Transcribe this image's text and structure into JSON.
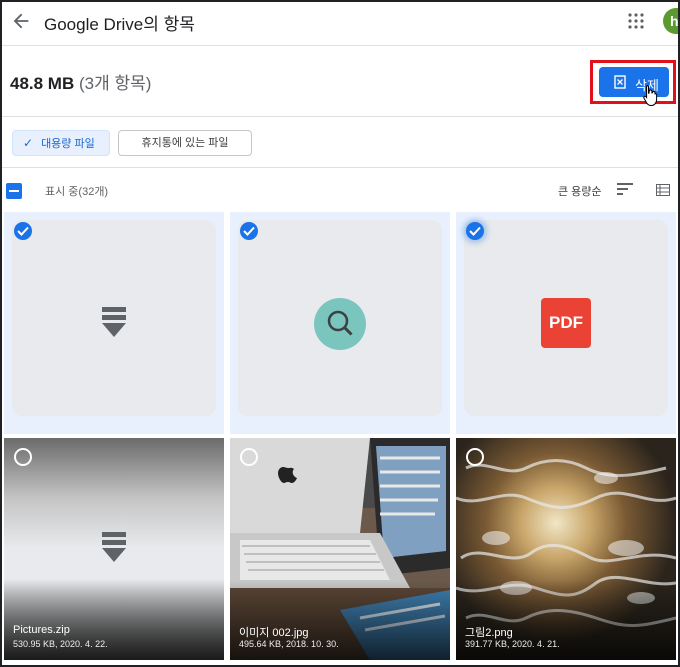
{
  "header": {
    "title": "Google Drive의 항목",
    "avatar_initial": "h"
  },
  "summary": {
    "size": "48.8 MB",
    "count": "(3개 항목)",
    "delete_label": "삭제"
  },
  "filters": {
    "large_files": "대용량 파일",
    "trash_files": "휴지통에 있는 파일"
  },
  "list": {
    "showing": "표시 중(32개)",
    "sort_label": "큰 용량순"
  },
  "files": [
    {
      "type": "zip-icon",
      "selected": true,
      "name": "",
      "meta": ""
    },
    {
      "type": "search-icon",
      "selected": true,
      "name": "",
      "meta": ""
    },
    {
      "type": "pdf-icon",
      "selected": true,
      "name": "",
      "meta": "",
      "badge": "PDF"
    },
    {
      "type": "zip-preview",
      "selected": false,
      "name": "Pictures.zip",
      "meta": "530.95 KB, 2020. 4. 22."
    },
    {
      "type": "photo-laptop",
      "selected": false,
      "name": "이미지 002.jpg",
      "meta": "495.64 KB, 2018. 10. 30."
    },
    {
      "type": "photo-texture",
      "selected": false,
      "name": "그림2.png",
      "meta": "391.77 KB, 2020. 4. 21."
    }
  ],
  "colors": {
    "accent": "#1a73e8",
    "highlight_border": "#e1101a",
    "selected_tile": "#e8f0fe",
    "pdf_red": "#ea4335",
    "search_teal": "#7ac5bd"
  }
}
